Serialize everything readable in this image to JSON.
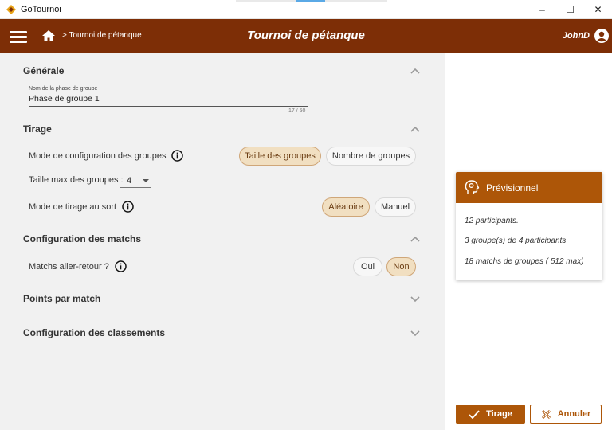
{
  "window": {
    "title": "GoTournoi",
    "minimize": "–",
    "maximize": "☐",
    "close": "✕"
  },
  "header": {
    "breadcrumb": "> Tournoi de pétanque",
    "title": "Tournoi de pétanque",
    "user": "JohnD"
  },
  "generale": {
    "title": "Générale",
    "field_label": "Nom de la phase de groupe",
    "field_value": "Phase de groupe 1",
    "field_counter": "17 / 50"
  },
  "tirage": {
    "title": "Tirage",
    "mode_config_label": "Mode de configuration des groupes",
    "mode_config_options": [
      "Taille des groupes",
      "Nombre de groupes"
    ],
    "mode_config_selected": "Taille des groupes",
    "taille_max_label": "Taille max des groupes :",
    "taille_max_value": "4",
    "mode_tirage_label": "Mode de tirage au sort",
    "mode_tirage_options": [
      "Aléatoire",
      "Manuel"
    ],
    "mode_tirage_selected": "Aléatoire"
  },
  "config_matchs": {
    "title": "Configuration des matchs",
    "aller_retour_label": "Matchs aller-retour ?",
    "aller_retour_options": [
      "Oui",
      "Non"
    ],
    "aller_retour_selected": "Non"
  },
  "points_par_match": {
    "title": "Points par match"
  },
  "config_classements": {
    "title": "Configuration des classements"
  },
  "previsionnel": {
    "title": "Prévisionnel",
    "line1": "12  participants.",
    "line2": "3  groupe(s) de  4  participants",
    "line3": "18  matchs de groupes ( 512  max)"
  },
  "actions": {
    "draw": "Tirage",
    "cancel": "Annuler"
  },
  "colors": {
    "header_bg": "#7d2e06",
    "accent": "#ad5608",
    "chip_selected": "#f1dfc1"
  }
}
